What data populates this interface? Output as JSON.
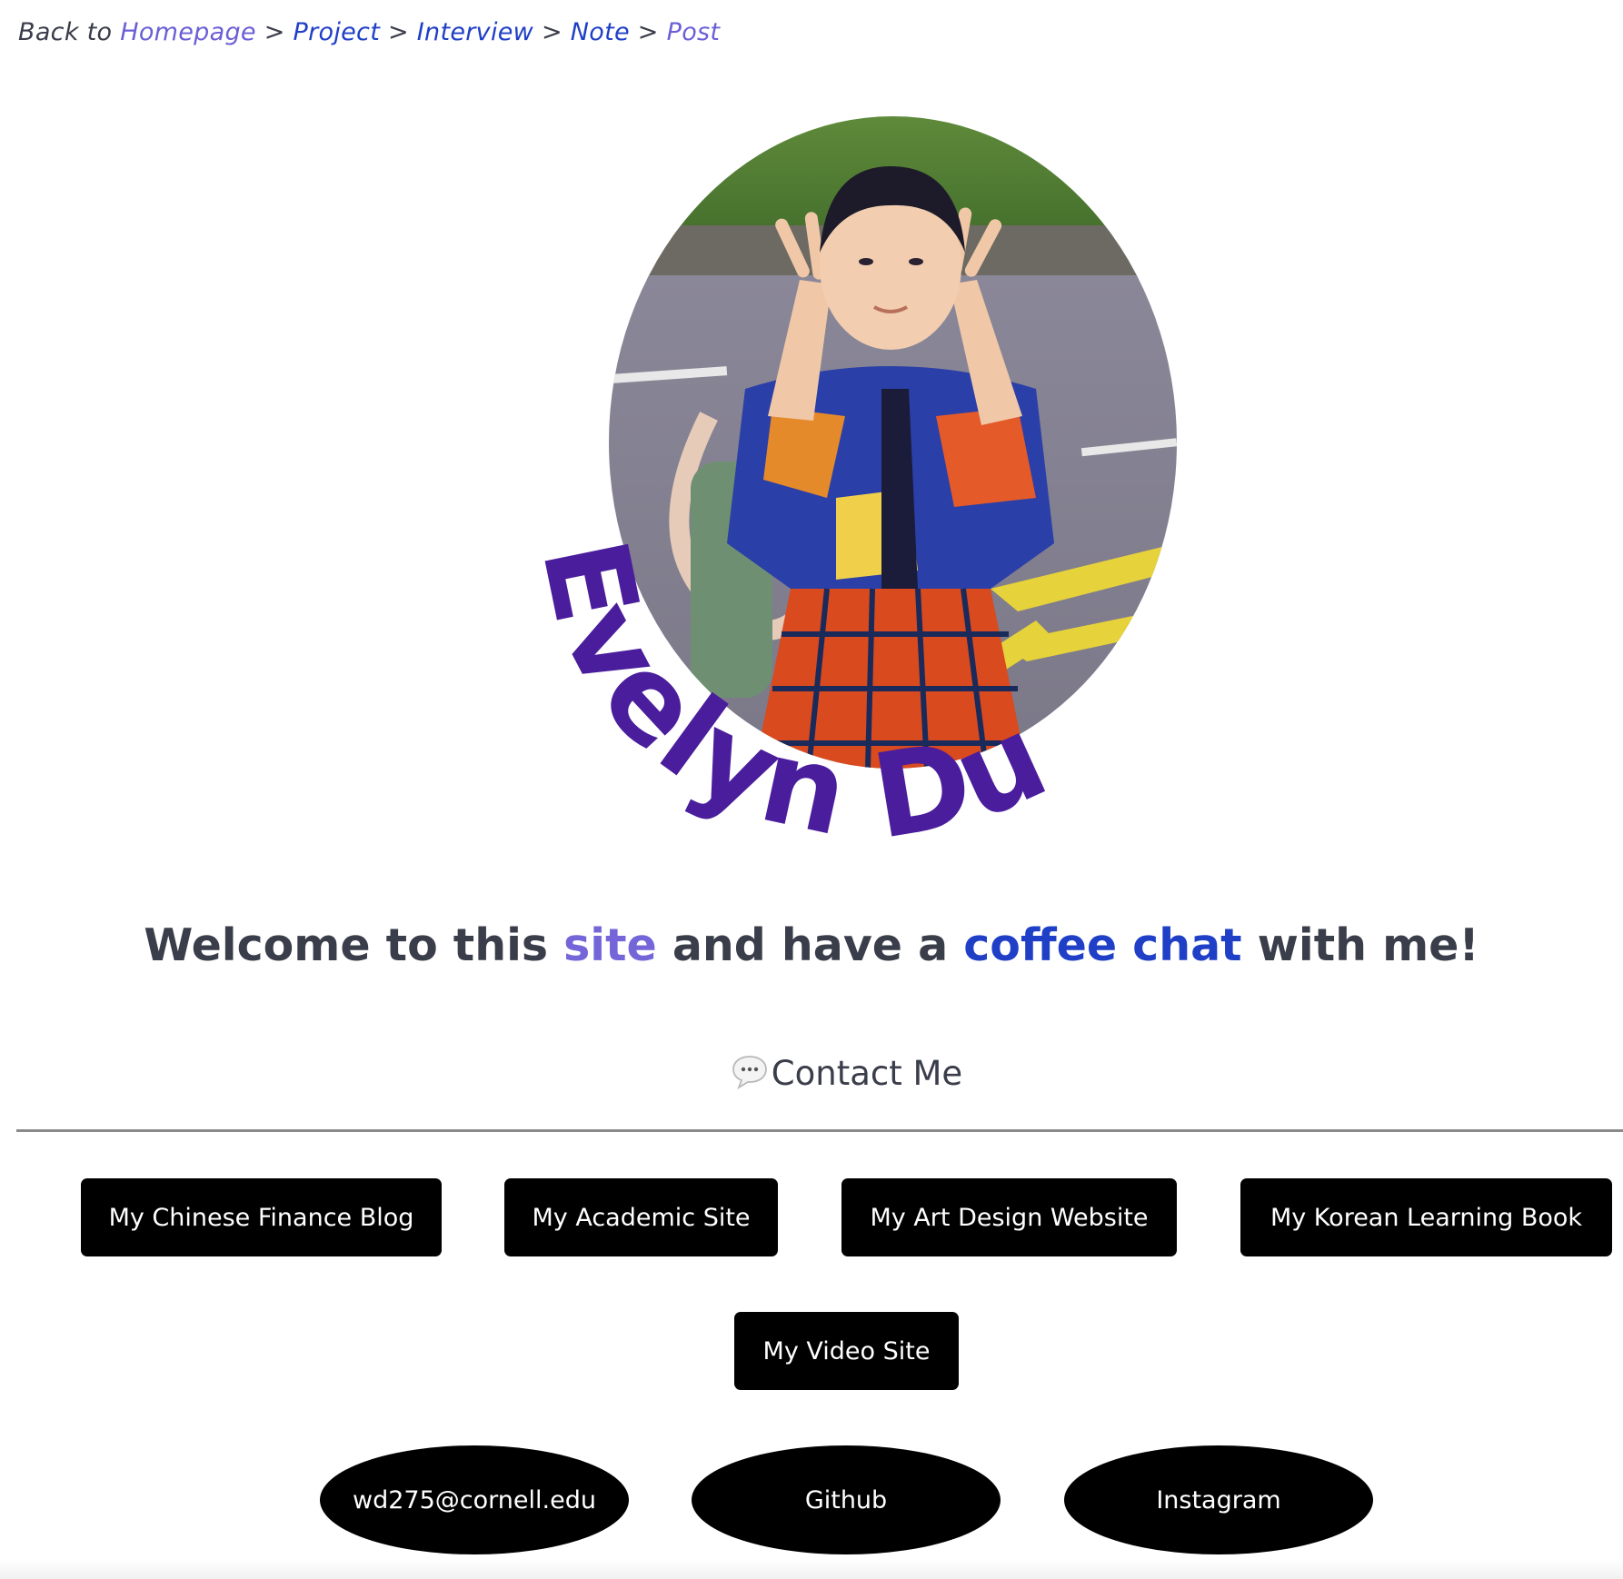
{
  "breadcrumb": {
    "prefix": "Back to",
    "separator": ">",
    "items": [
      "Homepage",
      "Project",
      "Interview",
      "Note",
      "Post"
    ]
  },
  "profile": {
    "name": "Evelyn Du",
    "name_color": "#4a1d9c",
    "portrait_icon": "portrait-photo"
  },
  "welcome": {
    "part1": "Welcome to this",
    "link1": "site",
    "part2": "and have a",
    "link2": "coffee chat",
    "part3": "with me!"
  },
  "contact": {
    "icon": "speech-bubble-icon",
    "title": "Contact Me"
  },
  "site_buttons": [
    "My Chinese Finance Blog",
    "My Academic Site",
    "My Art Design Website",
    "My Korean Learning Book",
    "My Video Site"
  ],
  "social_buttons": [
    "wd275@cornell.edu",
    "Github",
    "Instagram"
  ],
  "colors": {
    "visited_link": "#6a5fd6",
    "link": "#1f3fc7",
    "text": "#3a3d4a",
    "button_bg": "#000000",
    "button_text": "#ffffff"
  }
}
